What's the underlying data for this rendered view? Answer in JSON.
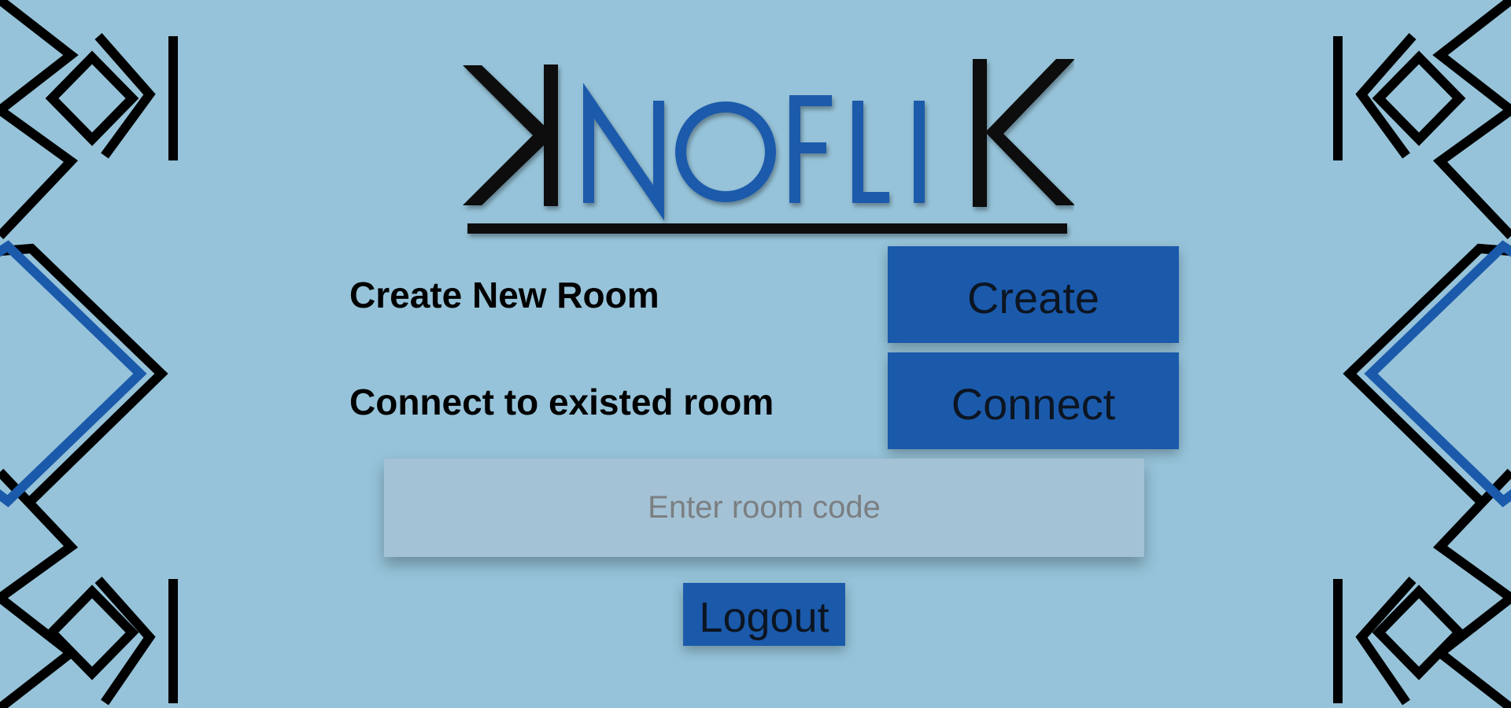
{
  "logo": {
    "text": "KNOFLIK",
    "accent_color": "#1b5aab",
    "dark_color": "#0a0a0a"
  },
  "create_row": {
    "label": "Create New Room",
    "button_label": "Create"
  },
  "connect_row": {
    "label": "Connect to existed room",
    "button_label": "Connect"
  },
  "room_code": {
    "value": "",
    "placeholder": "Enter room code"
  },
  "logout_label": "Logout",
  "colors": {
    "background": "#96c3d9",
    "button": "#1b5aab",
    "input": "#a4c2d5",
    "pattern_black": "#000000",
    "pattern_blue": "#1b5aab"
  }
}
